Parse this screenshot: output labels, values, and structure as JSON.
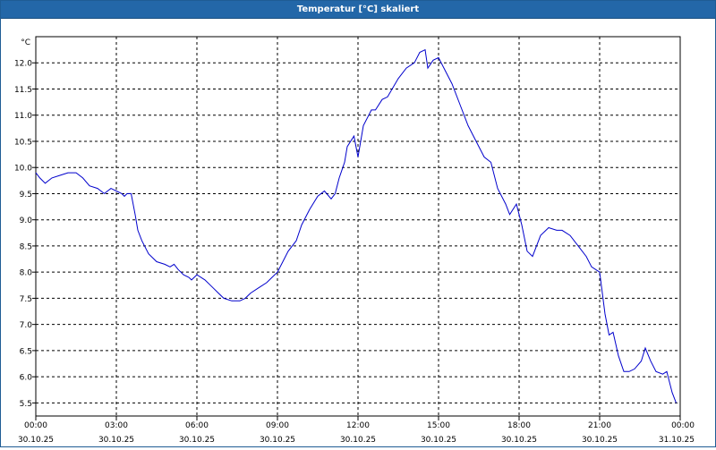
{
  "window": {
    "title": "Temperatur [°C] skaliert"
  },
  "chart_data": {
    "type": "line",
    "title": "Temperatur [°C] skaliert",
    "ylabel": "°C",
    "ylim": [
      5.25,
      12.5
    ],
    "xlim": [
      0,
      24
    ],
    "grid": true,
    "line_color": "#0000cc",
    "grid_color": "#000000",
    "y_ticks": [
      "5.5",
      "6.0",
      "6.5",
      "7.0",
      "7.5",
      "8.0",
      "8.5",
      "9.0",
      "9.5",
      "10.0",
      "10.5",
      "11.0",
      "11.5",
      "12.0"
    ],
    "x_ticks": [
      {
        "x": 0,
        "time": "00:00",
        "date": "30.10.25"
      },
      {
        "x": 3,
        "time": "03:00",
        "date": "30.10.25"
      },
      {
        "x": 6,
        "time": "06:00",
        "date": "30.10.25"
      },
      {
        "x": 9,
        "time": "09:00",
        "date": "30.10.25"
      },
      {
        "x": 12,
        "time": "12:00",
        "date": "30.10.25"
      },
      {
        "x": 15,
        "time": "15:00",
        "date": "30.10.25"
      },
      {
        "x": 18,
        "time": "18:00",
        "date": "30.10.25"
      },
      {
        "x": 21,
        "time": "21:00",
        "date": "30.10.25"
      },
      {
        "x": 24,
        "time": "00:00",
        "date": "31.10.25"
      }
    ],
    "series": [
      {
        "x": [
          0,
          0.15,
          0.35,
          0.6,
          0.9,
          1.2,
          1.35,
          1.5,
          1.75,
          2.0,
          2.3,
          2.55,
          2.8,
          3.0,
          3.2,
          3.3,
          3.4,
          3.55,
          3.7,
          3.8,
          3.95,
          4.2,
          4.5,
          4.8,
          5.0,
          5.15,
          5.3,
          5.5,
          5.7,
          5.8,
          6.0,
          6.3,
          6.6,
          6.8,
          7.0,
          7.3,
          7.6,
          7.8,
          8.0,
          8.3,
          8.6,
          8.8,
          9.0,
          9.2,
          9.4,
          9.7,
          9.9,
          10.2,
          10.5,
          10.75,
          11.0,
          11.15,
          11.3,
          11.5,
          11.6,
          11.85,
          12.0,
          12.2,
          12.5,
          12.65,
          12.9,
          13.1,
          13.5,
          13.8,
          14.1,
          14.3,
          14.5,
          14.6,
          14.8,
          15.0,
          15.2,
          15.5,
          15.8,
          16.1,
          16.4,
          16.7,
          16.95,
          17.2,
          17.5,
          17.65,
          17.9,
          18.1,
          18.3,
          18.5,
          18.8,
          19.1,
          19.4,
          19.6,
          19.9,
          20.2,
          20.5,
          20.7,
          21.0,
          21.2,
          21.35,
          21.5,
          21.7,
          21.9,
          22.1,
          22.3,
          22.55,
          22.7,
          22.9,
          23.1,
          23.35,
          23.5,
          23.7,
          23.85
        ],
        "y": [
          9.9,
          9.8,
          9.7,
          9.8,
          9.85,
          9.9,
          9.9,
          9.9,
          9.8,
          9.65,
          9.6,
          9.5,
          9.6,
          9.55,
          9.5,
          9.45,
          9.5,
          9.5,
          9.1,
          8.8,
          8.6,
          8.35,
          8.2,
          8.15,
          8.1,
          8.15,
          8.05,
          7.95,
          7.9,
          7.85,
          7.95,
          7.85,
          7.7,
          7.6,
          7.5,
          7.45,
          7.45,
          7.5,
          7.6,
          7.7,
          7.8,
          7.9,
          8.0,
          8.2,
          8.4,
          8.6,
          8.9,
          9.2,
          9.45,
          9.55,
          9.4,
          9.5,
          9.8,
          10.1,
          10.4,
          10.6,
          10.2,
          10.8,
          11.1,
          11.1,
          11.3,
          11.35,
          11.7,
          11.9,
          12.0,
          12.2,
          12.25,
          11.9,
          12.05,
          12.1,
          11.9,
          11.6,
          11.2,
          10.8,
          10.5,
          10.2,
          10.1,
          9.6,
          9.3,
          9.1,
          9.3,
          8.9,
          8.4,
          8.3,
          8.7,
          8.85,
          8.8,
          8.8,
          8.7,
          8.5,
          8.3,
          8.1,
          8.0,
          7.2,
          6.8,
          6.85,
          6.4,
          6.1,
          6.1,
          6.15,
          6.3,
          6.55,
          6.3,
          6.1,
          6.05,
          6.1,
          5.7,
          5.5
        ]
      }
    ]
  }
}
